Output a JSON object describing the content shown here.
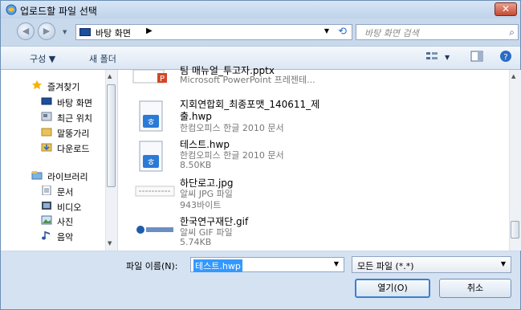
{
  "window": {
    "title": "업로드할 파일 선택",
    "close_label": "✕"
  },
  "nav": {
    "back_label": "◀",
    "forward_label": "▶",
    "history_drop": "▼"
  },
  "address": {
    "location": "바탕 화면",
    "separator": "▶",
    "drop": "▼",
    "refresh": "⟲"
  },
  "search": {
    "placeholder": "바탕 화면 검색",
    "icon": "⌕"
  },
  "toolbar": {
    "organize_label": "구성 ▼",
    "new_folder_label": "새 폴더",
    "view_drop": "▼",
    "help": "?"
  },
  "sidebar": {
    "items": [
      {
        "label": "즐겨찾기",
        "icon": "star-icon"
      },
      {
        "label": "바탕 화면",
        "icon": "desktop-icon"
      },
      {
        "label": "최근 위치",
        "icon": "recent-places-icon"
      },
      {
        "label": "말뚱가리",
        "icon": "folder-icon"
      },
      {
        "label": "다운로드",
        "icon": "downloads-icon"
      },
      {
        "label": "라이브러리",
        "icon": "library-icon"
      },
      {
        "label": "문서",
        "icon": "documents-icon"
      },
      {
        "label": "비디오",
        "icon": "video-icon"
      },
      {
        "label": "사진",
        "icon": "pictures-icon"
      },
      {
        "label": "음악",
        "icon": "music-icon"
      }
    ]
  },
  "files": [
    {
      "name": "팀 매뉴얼_투고자.pptx",
      "type": "Microsoft PowerPoint 프레젠테...",
      "size": ""
    },
    {
      "name": "지회연합회_최종포맷_140611_제",
      "name2": "출.hwp",
      "type": "한컴오피스 한글 2010 문서",
      "size": ""
    },
    {
      "name": "테스트.hwp",
      "type": "한컴오피스 한글 2010 문서",
      "size": "8.50KB"
    },
    {
      "name": "하단로고.jpg",
      "type": "알씨 JPG 파일",
      "size": "943바이트"
    },
    {
      "name": "한국연구재단.gif",
      "type": "알씨 GIF 파일",
      "size": "5.74KB"
    }
  ],
  "footer": {
    "filename_label": "파일 이름(N):",
    "filename_value": "테스트.hwp",
    "filetype_value": "모든 파일 (*.*)",
    "open_label": "열기(O)",
    "cancel_label": "취소",
    "drop": "▼"
  },
  "colors": {
    "selection": "#3399ff",
    "accent": "#2b6cc4",
    "close": "#c44a32"
  }
}
